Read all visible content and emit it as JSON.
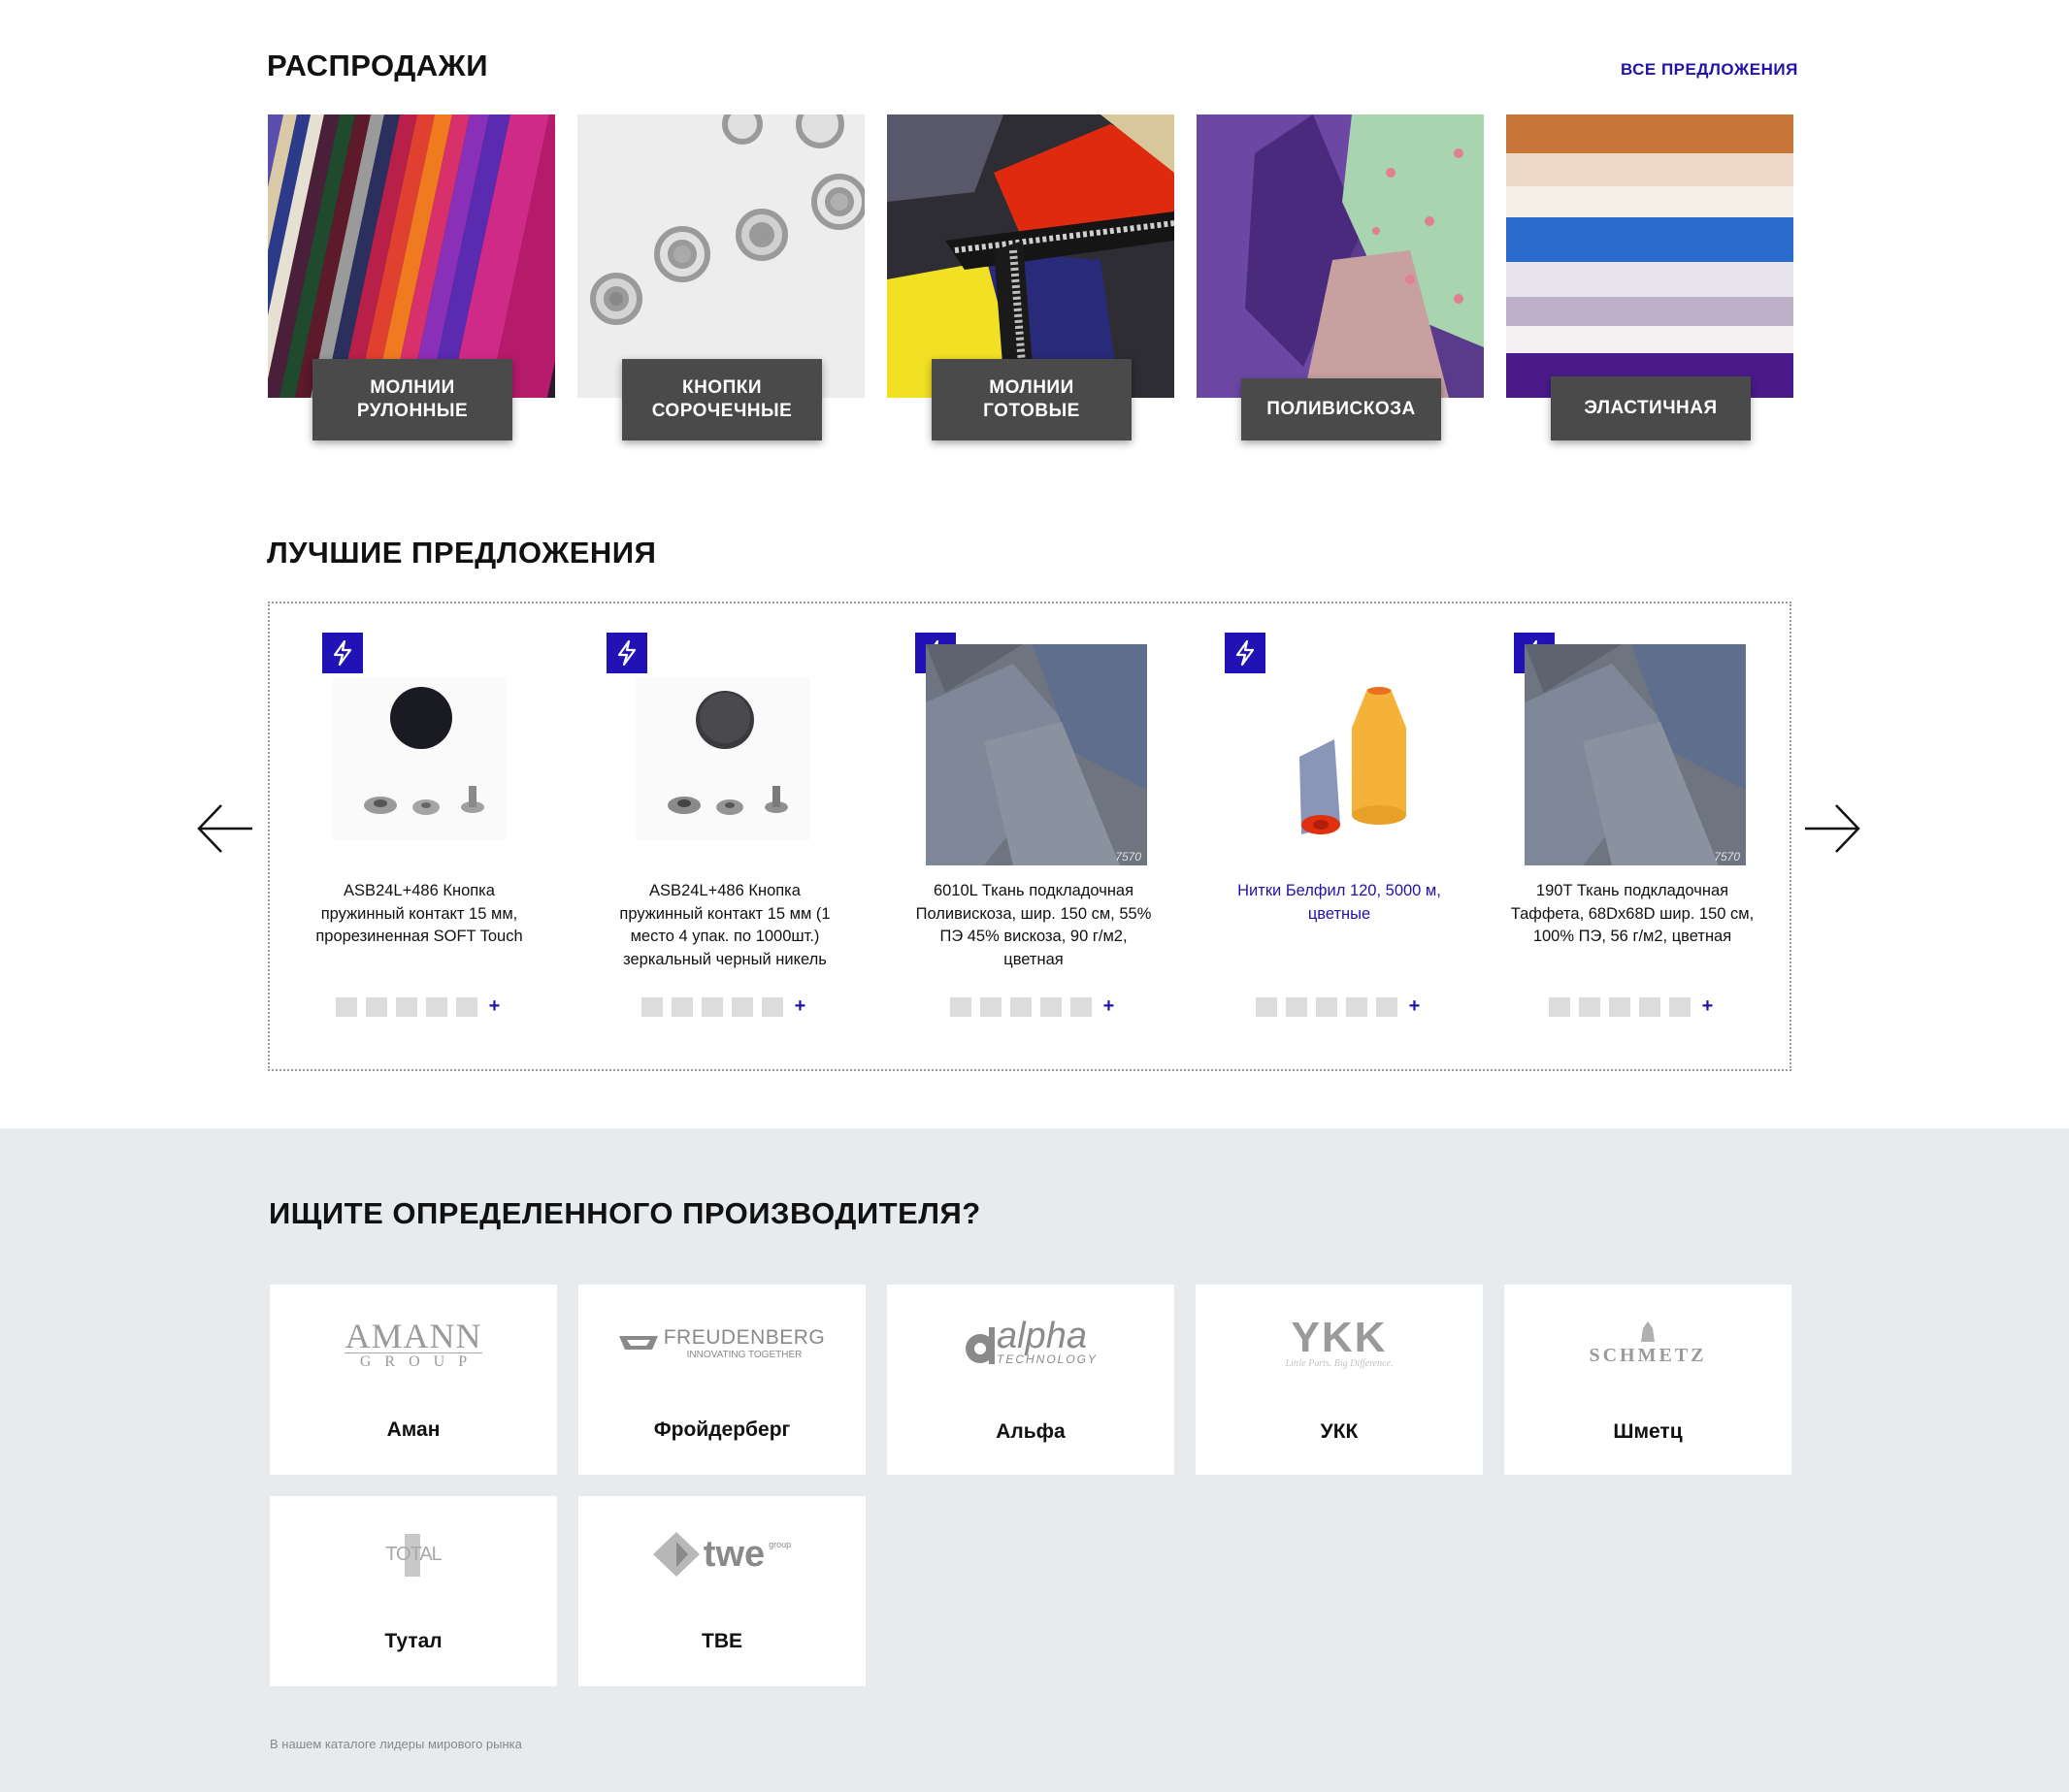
{
  "sales": {
    "title": "РАСПРОДАЖИ",
    "all_link": "ВСЕ ПРЕДЛОЖЕНИЯ",
    "categories": [
      {
        "label": "МОЛНИИ\nРУЛОННЫЕ"
      },
      {
        "label": "КНОПКИ\nСОРОЧЕЧНЫЕ"
      },
      {
        "label": "МОЛНИИ\nГОТОВЫЕ"
      },
      {
        "label": "ПОЛИВИСКОЗА"
      },
      {
        "label": "ЭЛАСТИЧНАЯ"
      }
    ]
  },
  "offers": {
    "title": "ЛУЧШИЕ ПРЕДЛОЖЕНИЯ",
    "products": [
      {
        "name": "ASB24L+486 Кнопка\nпружинный контакт 15 мм,\nпрорезиненная SOFT Touch",
        "plus": "+"
      },
      {
        "name": "ASB24L+486 Кнопка\nпружинный контакт 15 мм (1\nместо 4 упак. по 1000шт.)\nзеркальный черный никель",
        "plus": "+"
      },
      {
        "name": "6010L Ткань подкладочная\nПоливискоза, шир. 150 см, 55%\nПЭ 45% вискоза, 90 г/м2,\nцветная",
        "plus": "+",
        "image_text": "7570"
      },
      {
        "name": "Нитки Белфил 120, 5000 м,\nцветные",
        "plus": "+"
      },
      {
        "name": "190T Ткань подкладочная\nТаффета, 68Dx68D шир. 150 см,\n100% ПЭ, 56 г/м2, цветная",
        "plus": "+",
        "image_text": "7570"
      }
    ]
  },
  "manufacturers": {
    "title": "ИЩИТЕ ОПРЕДЕЛЕННОГО ПРОИЗВОДИТЕЛЯ?",
    "brands": [
      {
        "name": "Аман",
        "logo_main": "AMANN",
        "logo_sub": "GROUP"
      },
      {
        "name": "Фройдерберг",
        "logo_main": "FREUDENBERG",
        "logo_sub": "INNOVATING TOGETHER"
      },
      {
        "name": "Альфа",
        "logo_main": "alpha",
        "logo_sub": "TECHNOLOGY"
      },
      {
        "name": "УКК",
        "logo_main": "YKK",
        "logo_sub": "Little Parts. Big Difference."
      },
      {
        "name": "Шметц",
        "logo_main": "SCHMETZ",
        "logo_sub": ""
      },
      {
        "name": "Тутал",
        "logo_main": "TOTAL",
        "logo_sub": ""
      },
      {
        "name": "ТВЕ",
        "logo_main": "twe",
        "logo_sub": "group"
      }
    ],
    "footnote": "В нашем каталоге лидеры мирового рынка"
  },
  "colors": {
    "accent": "#2212a8",
    "badge": "#2012b5",
    "label_bg": "#4a4a4a",
    "band_bg": "#e8ebee"
  }
}
